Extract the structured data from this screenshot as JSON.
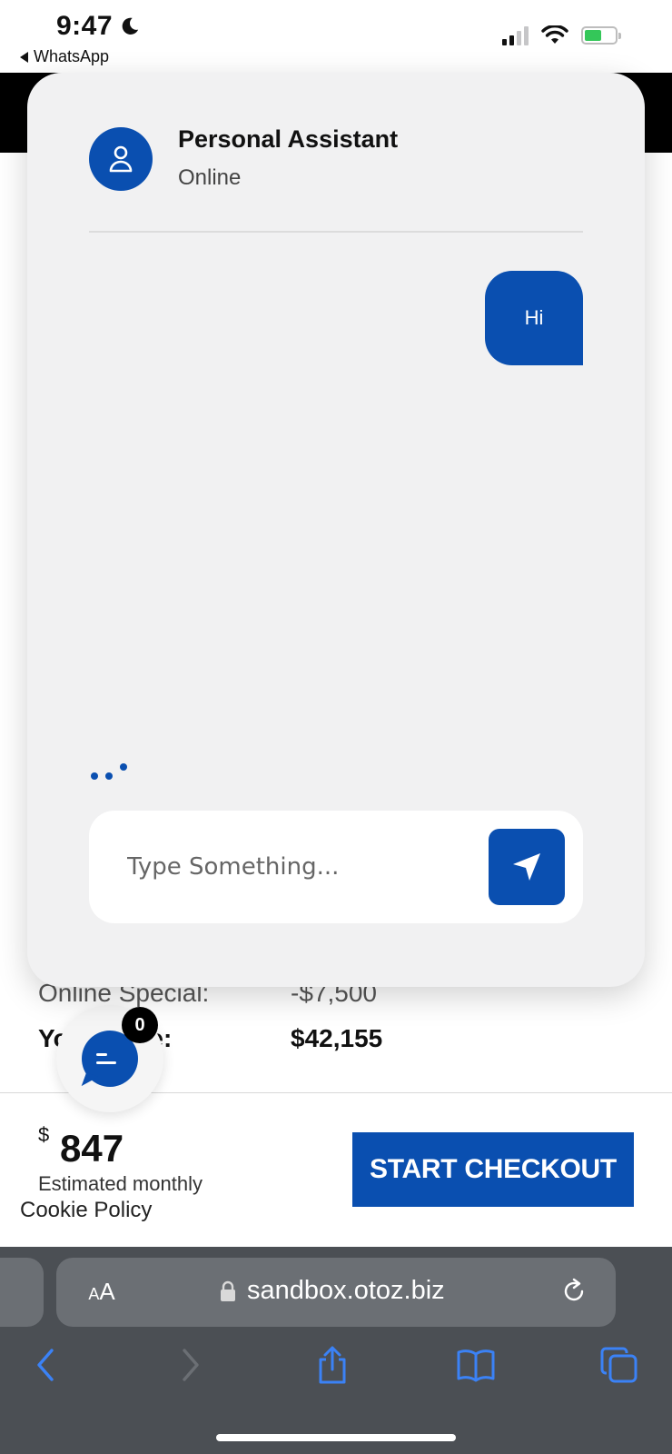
{
  "status_bar": {
    "time": "9:47",
    "back_app": "WhatsApp",
    "icons": [
      "moon-icon",
      "signal-icon",
      "wifi-icon",
      "battery-charging-icon"
    ]
  },
  "page": {
    "price_rows": [
      {
        "label": "Online Special:",
        "value": "-$7,500"
      },
      {
        "label": "Your Price:",
        "value": "$42,155"
      }
    ],
    "monthly_currency": "$",
    "monthly_amount": "847",
    "monthly_label": "Estimated monthly",
    "checkout_label": "START CHECKOUT",
    "cookie_label": "Cookie Policy"
  },
  "chat_launcher": {
    "badge_count": "0"
  },
  "chat": {
    "agent_name": "Personal Assistant",
    "agent_status": "Online",
    "messages": [
      {
        "sender": "user",
        "text": "Hi"
      }
    ],
    "input_placeholder": "Type Something...",
    "input_value": ""
  },
  "browser": {
    "text_size_small": "A",
    "text_size_big": "A",
    "url": "sandbox.otoz.biz",
    "toolbar_icons": [
      "back-icon",
      "forward-icon",
      "share-icon",
      "bookmarks-icon",
      "tabs-icon"
    ]
  },
  "colors": {
    "accent": "#0a4fb0",
    "panel_bg": "#f1f1f2",
    "safari_bg": "#4b4f54",
    "safari_icon": "#3b82f6"
  }
}
